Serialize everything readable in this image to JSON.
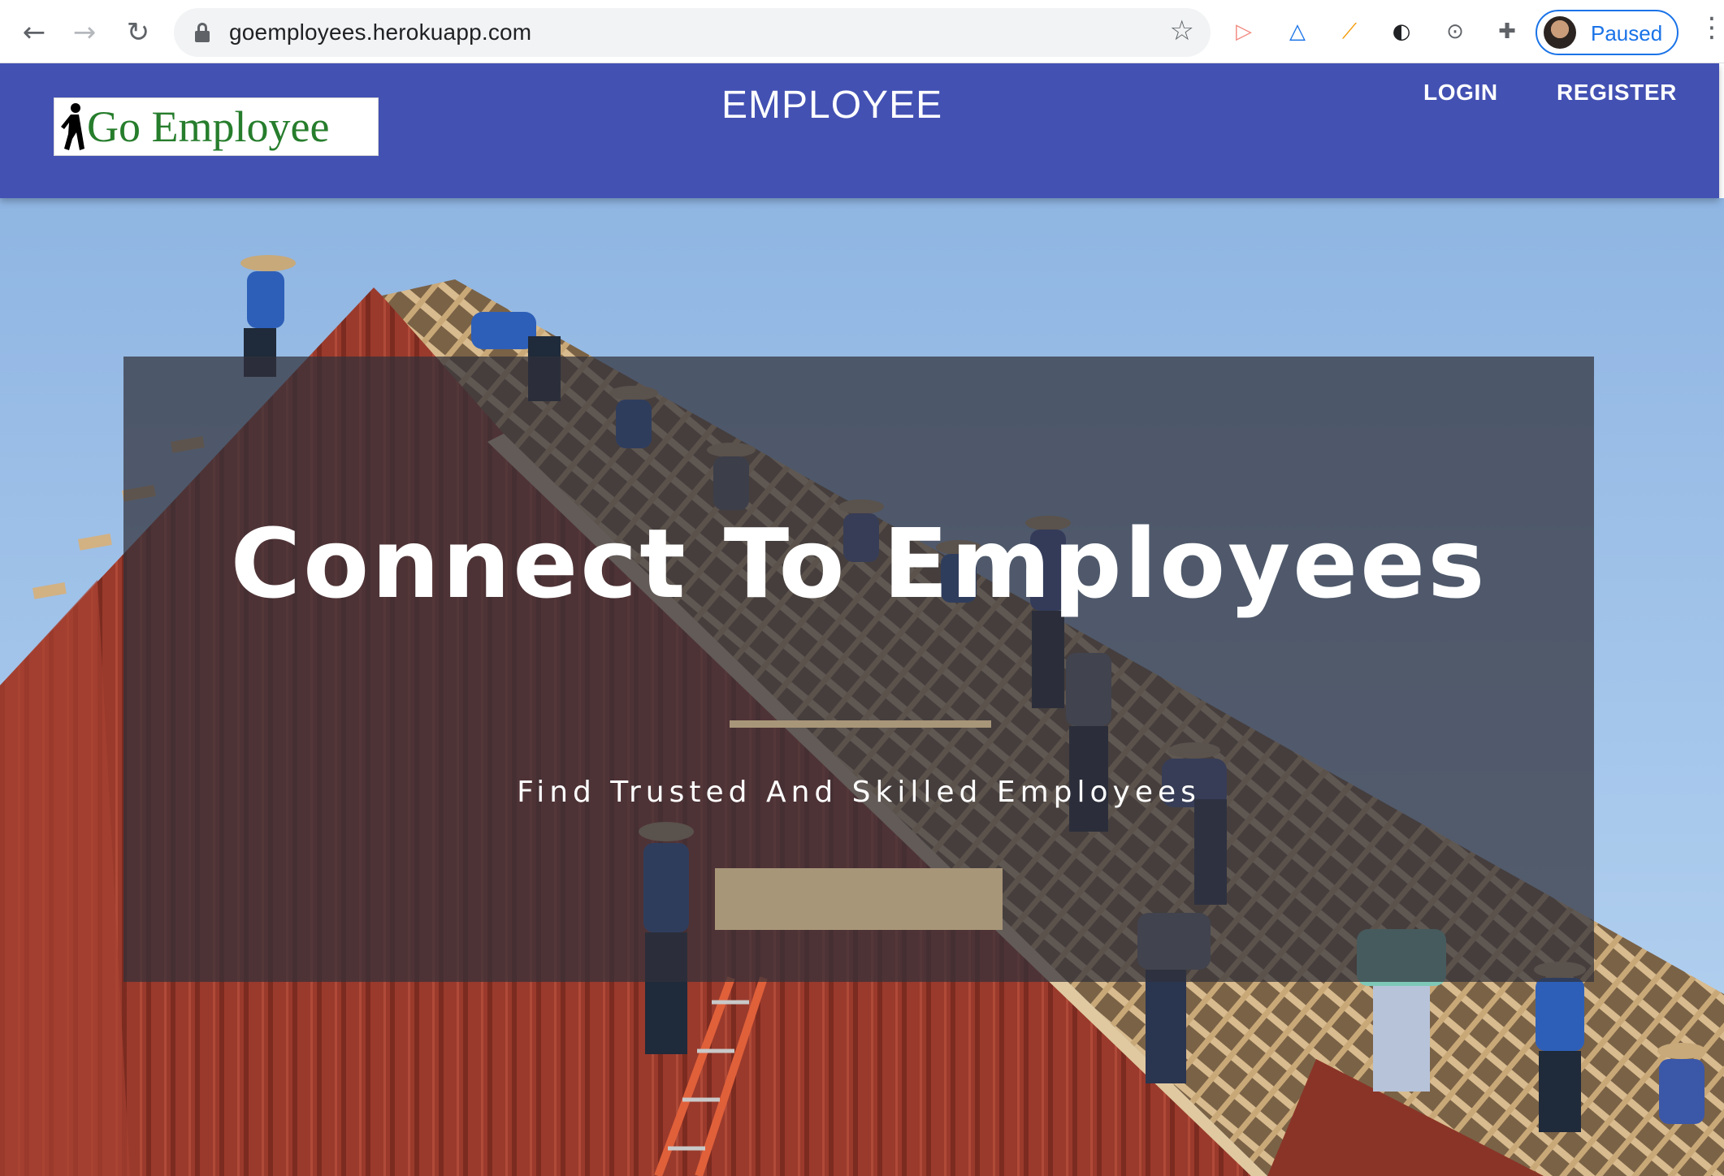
{
  "browser": {
    "url": "goemployees.herokuapp.com",
    "profile_status": "Paused",
    "back_glyph": "←",
    "forward_glyph": "→",
    "reload_glyph": "↻",
    "star_glyph": "☆",
    "menu_glyph": "⋮",
    "extensions": [
      {
        "name": "video-extension-icon",
        "glyph": "▷",
        "color": "#f28b82"
      },
      {
        "name": "ax-extension-icon",
        "glyph": "△",
        "color": "#1a73e8"
      },
      {
        "name": "carrot-extension-icon",
        "glyph": "⟋",
        "color": "#f29900"
      },
      {
        "name": "contrast-extension-icon",
        "glyph": "◐",
        "color": "#202124"
      },
      {
        "name": "json-extension-icon",
        "glyph": "⊙",
        "color": "#5f6368"
      },
      {
        "name": "puzzle-extensions-icon",
        "glyph": "✚",
        "color": "#5f6368"
      }
    ]
  },
  "header": {
    "logo_text": "Go Employee",
    "title": "EMPLOYEE",
    "nav": {
      "login": "LOGIN",
      "register": "REGISTER"
    },
    "bar_color": "#4351b3"
  },
  "hero": {
    "heading": "Connect To Employees",
    "subtitle": "Find Trusted And Skilled Employees",
    "cta_label": "",
    "accent_color": "#a89679"
  }
}
